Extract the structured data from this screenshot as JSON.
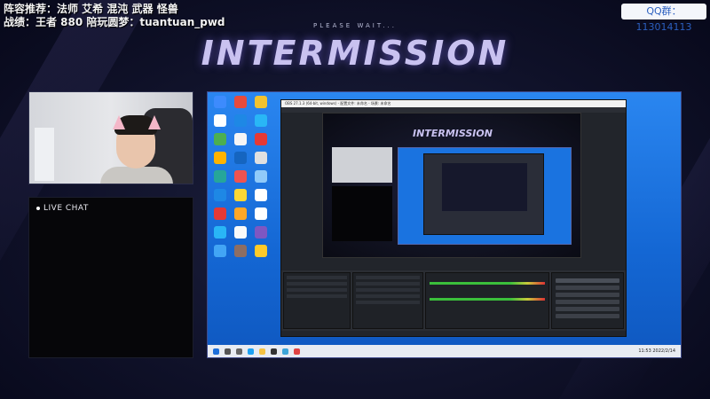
{
  "overlay": {
    "line1": "阵容推荐：法师 艾希 混沌 武器 怪兽",
    "line2": "战绩：王者 880 陪玩圆梦：tuantuan_pwd",
    "qq_badge": "QQ群：113014113",
    "please_wait": "PLEASE WAIT...",
    "title": "INTERMISSION"
  },
  "chat": {
    "title": "LIVE CHAT"
  },
  "screen": {
    "obs_title": "OBS 27.1.3 (64-bit, windows) - 配置文件: 未命名 - 场景: 未命名",
    "mini_title": "INTERMISSION",
    "clock": "11:53 2022/2/14"
  },
  "colors": {
    "background": "#10122a",
    "accent": "#c9c2f0",
    "qq_text": "#2b5fbf",
    "desktop_blue": "#1a73e0"
  }
}
